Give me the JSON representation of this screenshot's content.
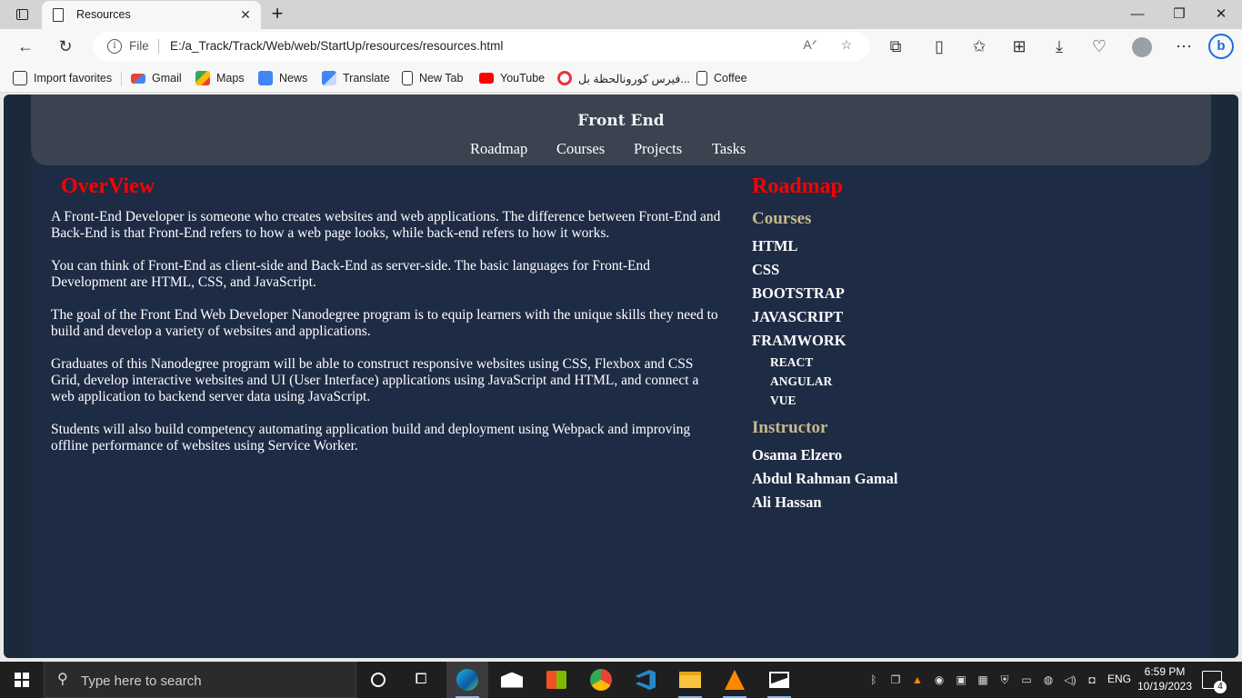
{
  "browser": {
    "tab": {
      "title": "Resources"
    },
    "address": {
      "scheme_label": "File",
      "url": "E:/a_Track/Track/Web/web/StartUp/resources/resources.html"
    },
    "favorites": [
      {
        "label": "Import favorites",
        "icon": "import-icon"
      },
      {
        "label": "Gmail",
        "icon": "gmail-icon"
      },
      {
        "label": "Maps",
        "icon": "maps-icon"
      },
      {
        "label": "News",
        "icon": "news-icon"
      },
      {
        "label": "Translate",
        "icon": "translate-icon"
      },
      {
        "label": "New Tab",
        "icon": "page-icon"
      },
      {
        "label": "YouTube",
        "icon": "youtube-icon"
      },
      {
        "label": "فيرس كورونالحظة بل...",
        "icon": "target-icon"
      },
      {
        "label": "Coffee",
        "icon": "page-icon"
      }
    ]
  },
  "site": {
    "brand": "Front End",
    "nav": [
      "Roadmap",
      "Courses",
      "Projects",
      "Tasks"
    ],
    "overview": {
      "title": "OverView",
      "paragraphs": [
        "A Front-End Developer is someone who creates websites and web applications. The difference between Front-End and Back-End is that Front-End refers to how a web page looks, while back-end refers to how it works.",
        "You can think of Front-End as client-side and Back-End as server-side. The basic languages for Front-End Development are HTML, CSS, and JavaScript.",
        "The goal of the Front End Web Developer Nanodegree program is to equip learners with the unique skills they need to build and develop a variety of websites and applications.",
        "Graduates of this Nanodegree program will be able to construct responsive websites using CSS, Flexbox and CSS Grid, develop interactive websites and UI (User Interface) applications using JavaScript and HTML, and connect a web application to backend server data using JavaScript.",
        "Students will also build competency automating application build and deployment using Webpack and improving offline performance of websites using Service Worker."
      ]
    },
    "roadmap": {
      "title": "Roadmap",
      "courses_title": "Courses",
      "courses": [
        "HTML",
        "CSS",
        "BOOTSTRAP",
        "JAVASCRIPT",
        "FRAMWORK"
      ],
      "frameworks": [
        "REACT",
        "ANGULAR",
        "VUE"
      ],
      "instructor_title": "Instructor",
      "instructors": [
        "Osama Elzero",
        "Abdul Rahman Gamal",
        "Ali Hassan"
      ]
    }
  },
  "taskbar": {
    "search_placeholder": "Type here to search",
    "language": "ENG",
    "time": "6:59 PM",
    "date": "10/19/2023",
    "notification_count": "4"
  },
  "colors": {
    "page_bg": "#1e2b45",
    "nav_bg": "#3b4250",
    "heading_red": "#ff0000",
    "subheading_gold": "#c8b98a"
  }
}
